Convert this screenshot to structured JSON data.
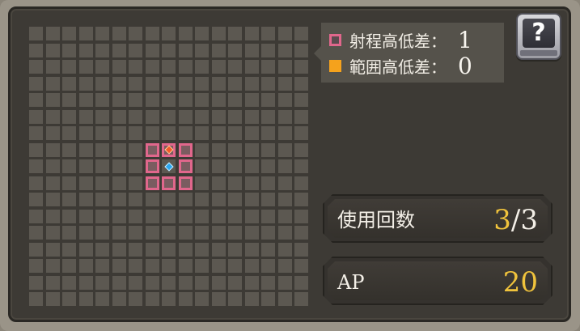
{
  "legend": {
    "range_height_label": "射程高低差：",
    "range_height_value": "1",
    "area_height_label": "範囲高低差：",
    "area_height_value": "0"
  },
  "help": {
    "icon": "?"
  },
  "stats": {
    "uses_label": "使用回数",
    "uses_current": "3",
    "uses_separator": "/",
    "uses_max": "3",
    "ap_label": "AP",
    "ap_value": "20"
  },
  "colors": {
    "range": "#e0678c",
    "area": "#f5a21c",
    "target_marker": "#f25a2a",
    "user_marker": "#29a6f0",
    "gold_text": "#f0c33c"
  },
  "grid": {
    "columns": 17,
    "rows": 17,
    "range_cells": [
      [
        7,
        7
      ],
      [
        8,
        7
      ],
      [
        9,
        7
      ],
      [
        7,
        8
      ],
      [
        9,
        8
      ],
      [
        7,
        9
      ],
      [
        8,
        9
      ],
      [
        9,
        9
      ]
    ],
    "target_cell": [
      8,
      7
    ],
    "user_cell": [
      8,
      8
    ]
  }
}
